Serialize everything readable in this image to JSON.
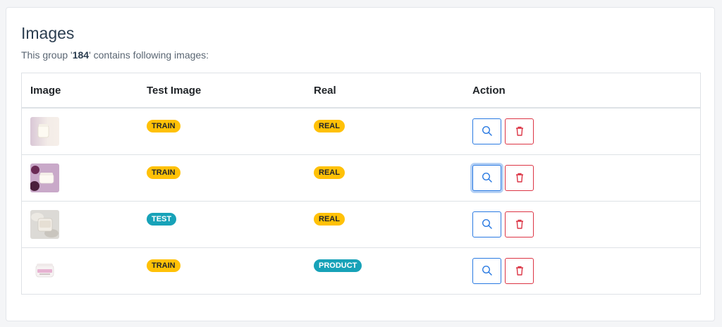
{
  "panel": {
    "title": "Images",
    "subtitle_prefix": "This group '",
    "group_id": "184",
    "subtitle_suffix": "' contains following images:"
  },
  "table": {
    "headers": [
      "Image",
      "Test Image",
      "Real",
      "Action"
    ],
    "rows": [
      {
        "test_image": "TRAIN",
        "test_color": "#ffc107",
        "real": "REAL",
        "real_color": "#ffc107",
        "thumb": "cream-jar-white-bg"
      },
      {
        "test_image": "TRAIN",
        "test_color": "#ffc107",
        "real": "REAL",
        "real_color": "#ffc107",
        "thumb": "cream-jar-purple-bg"
      },
      {
        "test_image": "TEST",
        "test_color": "#17a2b8",
        "real": "REAL",
        "real_color": "#ffc107",
        "thumb": "cream-jar-open-lid"
      },
      {
        "test_image": "TRAIN",
        "test_color": "#ffc107",
        "real": "PRODUCT",
        "real_color": "#17a2b8",
        "thumb": "product-jar-pink-label"
      }
    ]
  },
  "actions": {
    "view_icon": "search-icon",
    "delete_icon": "trash-icon",
    "view_color": "#2a7ae2",
    "delete_color": "#dc3545"
  }
}
